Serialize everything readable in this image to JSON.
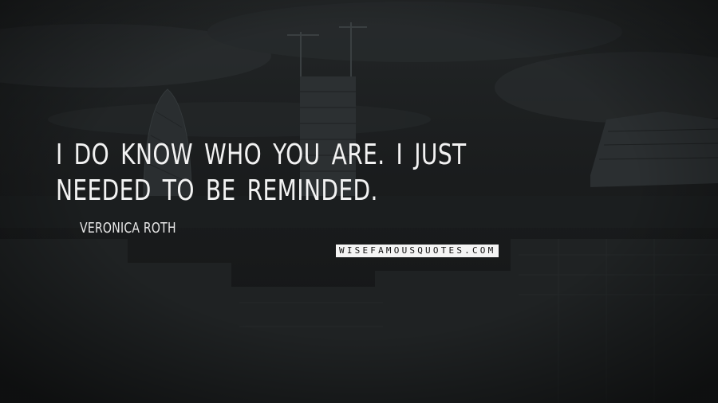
{
  "quote": {
    "text": "I do know who you are. I just needed to be reminded."
  },
  "author": {
    "name": "Veronica Roth"
  },
  "watermark": {
    "text": "WISEFAMOUSQUOTES.COM"
  },
  "colors": {
    "text": "#f2f2f2",
    "badge_background": "#f4f4f4",
    "badge_text": "#111111",
    "background": "#1a1c1d"
  }
}
